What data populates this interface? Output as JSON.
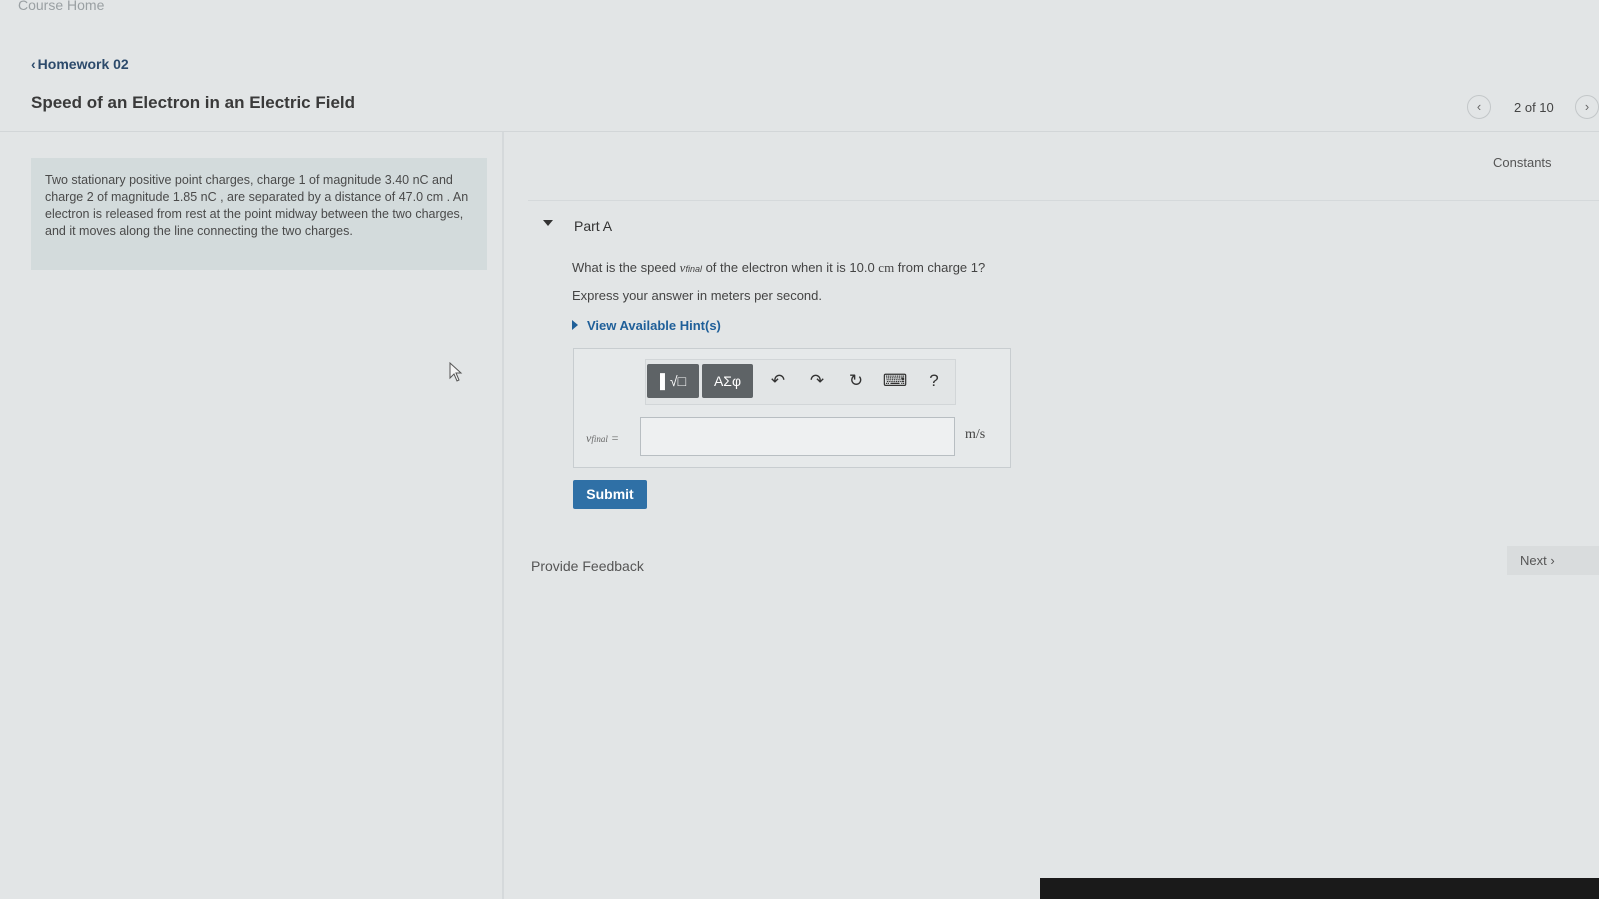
{
  "header": {
    "course_home": "Course Home",
    "back_link": "Homework 02",
    "title": "Speed of an Electron in an Electric Field",
    "pager": {
      "prev_icon": "chevron-left-icon",
      "count": "2 of 10",
      "next_icon": "chevron-right-icon"
    }
  },
  "problem": {
    "text": "Two stationary positive point charges, charge 1 of magnitude 3.40 nC and charge 2 of magnitude 1.85 nC , are separated by a distance of 47.0 cm . An electron is released from rest at the point midway between the two charges, and it moves along the line connecting the two charges."
  },
  "constants_link": "Constants",
  "part": {
    "label": "Part A",
    "question_prefix": "What is the speed ",
    "question_var": "v",
    "question_sub": "final",
    "question_mid": " of the electron when it is 10.0 ",
    "question_unit": "cm",
    "question_suffix": " from charge 1?",
    "instruction": "Express your answer in meters per second.",
    "hints": "View Available Hint(s)"
  },
  "answer": {
    "toolbar": {
      "templates_label": "▌√□",
      "symbols_label": "ΑΣφ",
      "undo": "↶",
      "redo": "↷",
      "reset": "↻",
      "keyboard": "⌨",
      "help": "?"
    },
    "var_label": "v",
    "var_sub": "final",
    "var_eq": " =",
    "value": "",
    "unit": "m/s"
  },
  "submit_label": "Submit",
  "feedback_label": "Provide Feedback",
  "next_label": "Next",
  "next_chevron": "›"
}
